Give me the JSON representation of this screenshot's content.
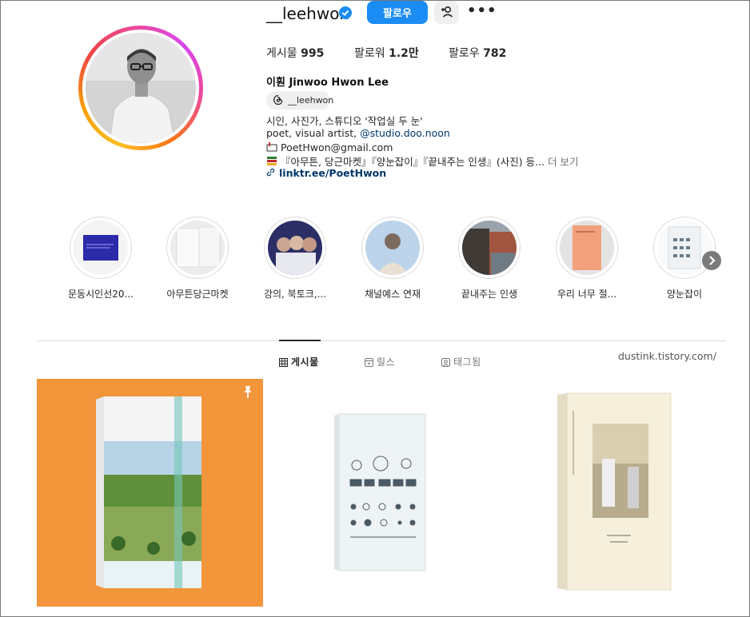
{
  "profile": {
    "username": "__leehwon",
    "follow_label": "팔로우",
    "stats": {
      "posts_label": "게시물",
      "posts_value": "995",
      "followers_label": "팔로워",
      "followers_value": "1.2만",
      "following_label": "팔로우",
      "following_value": "782"
    },
    "full_name": "이훤 Jinwoo Hwon Lee",
    "threads_handle": "__leehwon",
    "bio": {
      "line1": "시인, 사진가, 스튜디오 '작업실 두 눈'",
      "line2_text": "poet, visual artist, ",
      "line2_link": "@studio.doo.noon",
      "line3": "PoetHwon@gmail.com",
      "line4": "『아무튼, 당근마켓』『양눈잡이』『끝내주는 인생』(사진) 등...",
      "more": "더 보기"
    },
    "link": "linktr.ee/PoetHwon"
  },
  "highlights": [
    {
      "label": "문동시인선20..."
    },
    {
      "label": "아무튼당근마켓"
    },
    {
      "label": "강의, 북토크,..."
    },
    {
      "label": "채널예스 연재"
    },
    {
      "label": "끝내주는 인생"
    },
    {
      "label": "우리 너무 절..."
    },
    {
      "label": "양눈잡이"
    }
  ],
  "tabs": [
    {
      "label": "게시물",
      "icon": "grid-icon",
      "active": true
    },
    {
      "label": "릴스",
      "icon": "reels-icon",
      "active": false
    },
    {
      "label": "태그됨",
      "icon": "tagged-icon",
      "active": false
    }
  ],
  "watermark": "dustink.tistory.com/",
  "colors": {
    "accent": "#1b8cf3",
    "link": "#00376b",
    "post1_bg": "#f2953b",
    "post3_bg": "#ffffff"
  },
  "posts": [
    {
      "icon": "pin-icon"
    },
    {},
    {}
  ]
}
